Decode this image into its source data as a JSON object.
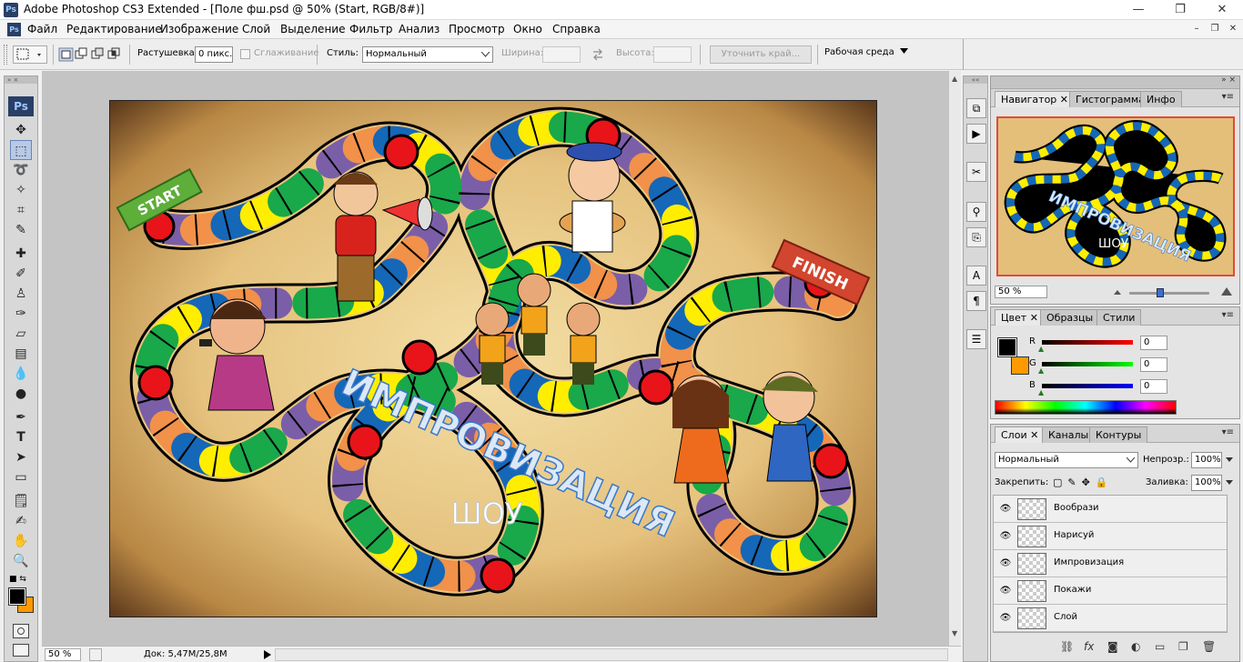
{
  "window": {
    "title": "Adobe Photoshop CS3 Extended - [Поле фш.psd @ 50% (Start, RGB/8#)]",
    "logo": "Ps",
    "minimize_glyph": "—",
    "maximize_glyph": "❐",
    "close_glyph": "✕"
  },
  "menu": {
    "items": [
      "Файл",
      "Редактирование",
      "Изображение",
      "Слой",
      "Выделение",
      "Фильтр",
      "Анализ",
      "Просмотр",
      "Окно",
      "Справка"
    ],
    "doc_minimize": "–",
    "doc_restore": "❐",
    "doc_close": "✕"
  },
  "options": {
    "feather_label": "Растушевка:",
    "feather_value": "0 пикс.",
    "antialias_label": "Сглаживание",
    "style_label": "Стиль:",
    "style_value": "Нормальный",
    "width_label": "Ширина:",
    "height_label": "Высота:",
    "refine_edge_label": "Уточнить край...",
    "workspace_label": "Рабочая среда"
  },
  "toolbox": {
    "logo": "Ps"
  },
  "canvas": {
    "start_label": "START",
    "finish_label": "FINISH",
    "title_line1": "ИМПРОВИЗАЦИЯ",
    "title_line2": "ШОУ"
  },
  "status": {
    "zoom": "50 %",
    "doc_size": "Док: 5,47M/25,8M"
  },
  "navigator": {
    "tabs": [
      "Навигатор",
      "Гистограмма",
      "Инфо"
    ],
    "zoom": "50 %",
    "thumb_title": "ИМПРОВИЗАЦИЯ",
    "thumb_sub": "ШОУ"
  },
  "color": {
    "tabs": [
      "Цвет",
      "Образцы",
      "Стили"
    ],
    "r_label": "R",
    "g_label": "G",
    "b_label": "B",
    "r_value": "0",
    "g_value": "0",
    "b_value": "0",
    "foreground": "#000000",
    "background": "#ff9900"
  },
  "layers": {
    "tabs": [
      "Слои",
      "Каналы",
      "Контуры"
    ],
    "blend_mode": "Нормальный",
    "opacity_label": "Непрозр.:",
    "opacity_value": "100%",
    "lock_label": "Закрепить:",
    "fill_label": "Заливка:",
    "fill_value": "100%",
    "items": [
      {
        "name": "Вообрази"
      },
      {
        "name": "Нарисуй"
      },
      {
        "name": "Импровизация"
      },
      {
        "name": "Покажи"
      },
      {
        "name": "Слой"
      }
    ]
  }
}
